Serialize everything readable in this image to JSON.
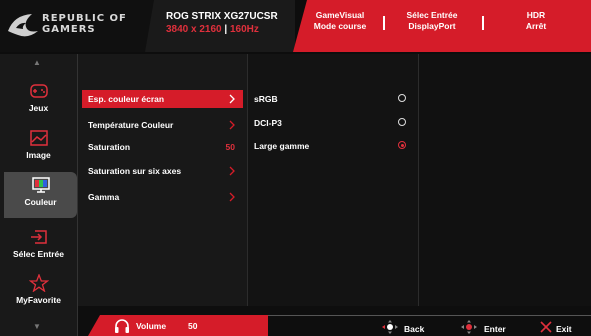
{
  "header": {
    "brand_line1": "REPUBLIC OF",
    "brand_line2": "GAMERS",
    "model_name": "ROG STRIX XG27UCSR",
    "resolution": "3840 x 2160",
    "refresh_rate": "160Hz",
    "status": [
      {
        "title": "GameVisual",
        "value": "Mode course"
      },
      {
        "title": "Sélec Entrée",
        "value": "DisplayPort"
      },
      {
        "title": "HDR",
        "value": "Arrêt"
      }
    ]
  },
  "sidebar": {
    "items": [
      {
        "label": "Jeux",
        "icon": "gamepad-icon"
      },
      {
        "label": "Image",
        "icon": "image-icon"
      },
      {
        "label": "Couleur",
        "icon": "monitor-color-icon",
        "active": true
      },
      {
        "label": "Sélec Entrée",
        "icon": "input-select-icon"
      },
      {
        "label": "MyFavorite",
        "icon": "star-icon"
      }
    ]
  },
  "menu": {
    "items": [
      {
        "label": "Esp. couleur écran",
        "selected": true
      },
      {
        "label": "Température Couleur"
      },
      {
        "label": "Saturation",
        "value": "50"
      },
      {
        "label": "Saturation sur six axes"
      },
      {
        "label": "Gamma"
      }
    ]
  },
  "submenu": {
    "options": [
      {
        "label": "sRGB",
        "checked": false
      },
      {
        "label": "DCI-P3",
        "checked": false
      },
      {
        "label": "Large gamme",
        "checked": true
      }
    ]
  },
  "footer": {
    "volume_label": "Volume",
    "volume_value": "50",
    "back_label": "Back",
    "enter_label": "Enter",
    "exit_label": "Exit"
  },
  "colors": {
    "accent": "#d51c29",
    "highlight_text": "#e0303c",
    "background": "#0d0d0d"
  }
}
